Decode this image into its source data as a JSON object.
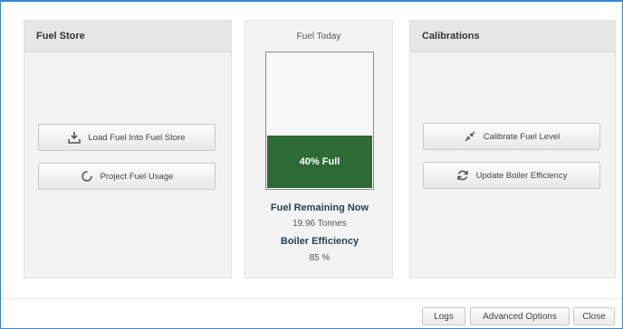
{
  "fuel_store": {
    "title": "Fuel Store",
    "load_button": "Load Fuel Into Fuel Store",
    "project_button": "Project Fuel Usage"
  },
  "fuel_today": {
    "title": "Fuel Today",
    "fill_label": "40% Full",
    "fill_fraction": 0.4,
    "remaining_heading": "Fuel Remaining Now",
    "remaining_value": "19.96 Tonnes",
    "efficiency_heading": "Boiler Efficiency",
    "efficiency_value": "85 %"
  },
  "calibrations": {
    "title": "Calibrations",
    "calibrate_button": "Calibrate Fuel Level",
    "update_button": "Update Boiler Efficiency"
  },
  "footer": {
    "logs": "Logs",
    "advanced": "Advanced Options",
    "close": "Close"
  },
  "colors": {
    "gauge_fill": "#2d6a36",
    "frame_border": "#3f85c4"
  }
}
